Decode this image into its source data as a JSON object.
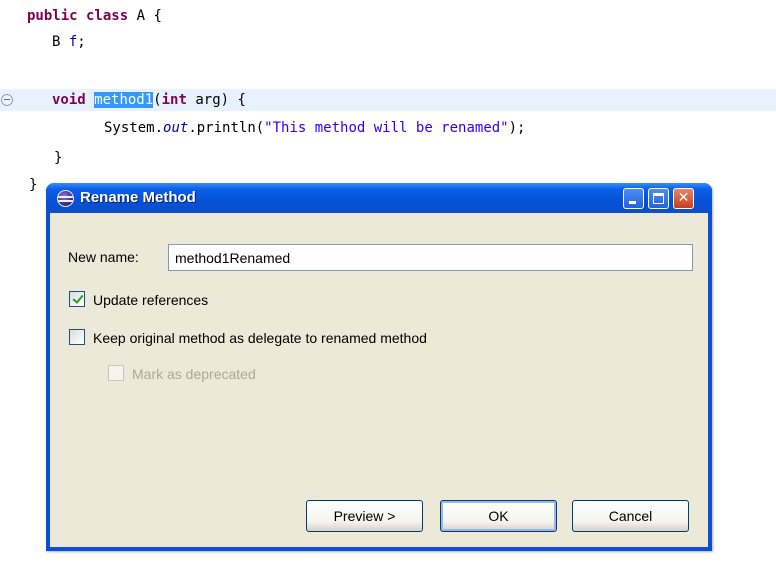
{
  "editor": {
    "lines": {
      "l1": {
        "kw": "public class",
        "rest": " A {"
      },
      "l2": {
        "type": "B ",
        "field": "f",
        "semi": ";"
      },
      "l4": {
        "kw_void": "void",
        "space": " ",
        "selected": "method1",
        "paren": "(",
        "kw_int": "int",
        "rest": " arg) {"
      },
      "l5": {
        "pre": "System.",
        "static_field": "out",
        "mid": ".println(",
        "str": "\"This method will be renamed\"",
        "end": ");"
      },
      "l6": {
        "text": "}"
      },
      "l7": {
        "text": "}"
      }
    }
  },
  "dialog": {
    "title": "Rename Method",
    "new_name_label": "New name:",
    "new_name_value": "method1Renamed",
    "update_references_label": "Update references",
    "update_references_checked": true,
    "keep_original_label": "Keep original method as delegate to renamed method",
    "keep_original_checked": false,
    "mark_deprecated_label": "Mark as deprecated",
    "mark_deprecated_checked": false,
    "mark_deprecated_enabled": false,
    "buttons": {
      "preview": "Preview >",
      "ok": "OK",
      "cancel": "Cancel"
    },
    "titlebar_buttons": {
      "close_glyph": "✕"
    },
    "colors": {
      "titlebar": "#0552d6",
      "client": "#ece9d8",
      "selection": "#3399ff"
    }
  }
}
